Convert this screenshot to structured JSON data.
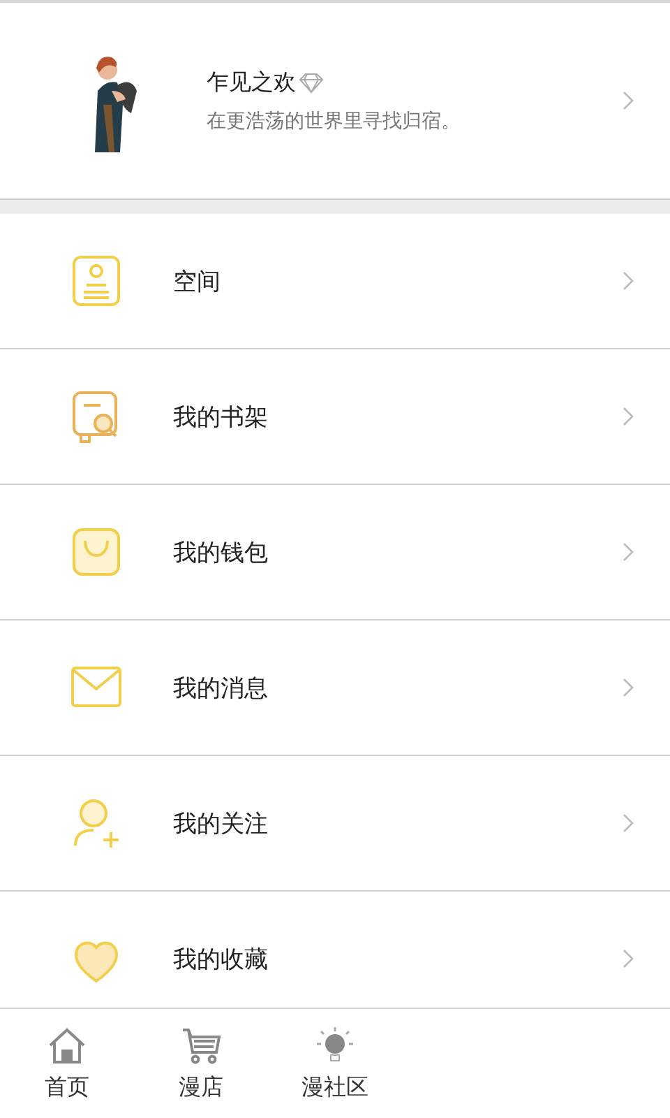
{
  "profile": {
    "name": "乍见之欢",
    "subtitle": "在更浩荡的世界里寻找归宿。"
  },
  "menu": [
    {
      "kind": "space",
      "label": "空间"
    },
    {
      "kind": "bookshelf",
      "label": "我的书架"
    },
    {
      "kind": "wallet",
      "label": "我的钱包"
    },
    {
      "kind": "messages",
      "label": "我的消息"
    },
    {
      "kind": "follows",
      "label": "我的关注"
    },
    {
      "kind": "favorites",
      "label": "我的收藏"
    }
  ],
  "tab_bar": [
    {
      "kind": "home",
      "label": "首页",
      "selected": false
    },
    {
      "kind": "shop",
      "label": "漫店",
      "selected": false
    },
    {
      "kind": "community",
      "label": "漫社区",
      "selected": false
    }
  ]
}
